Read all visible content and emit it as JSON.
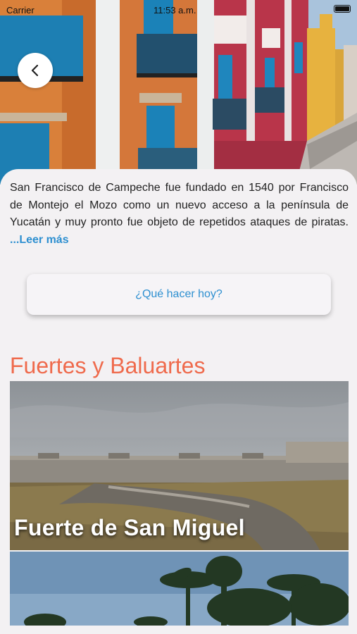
{
  "status_bar": {
    "carrier": "Carrier",
    "time": "11:53 a.m."
  },
  "hero": {
    "image": "colonial-street-photo",
    "back_icon": "chevron-left-icon"
  },
  "description": {
    "text": "San Francisco de Campeche fue fundado en 1540 por Francisco de Montejo el Mozo como un nuevo acceso a la península de Yucatán y muy pronto fue objeto de repetidos ataques de piratas.",
    "read_more": "...Leer más"
  },
  "today_button": {
    "label": "¿Qué hacer hoy?"
  },
  "section": {
    "title": "Fuertes y Baluartes",
    "places": [
      {
        "name": "Fuerte de San Miguel",
        "image": "fort-photo"
      },
      {
        "name": "",
        "image": "palm-trees-photo"
      }
    ]
  },
  "colors": {
    "accent": "#ef6a4c",
    "link": "#2d8fd0",
    "background": "#f3f1f3"
  }
}
